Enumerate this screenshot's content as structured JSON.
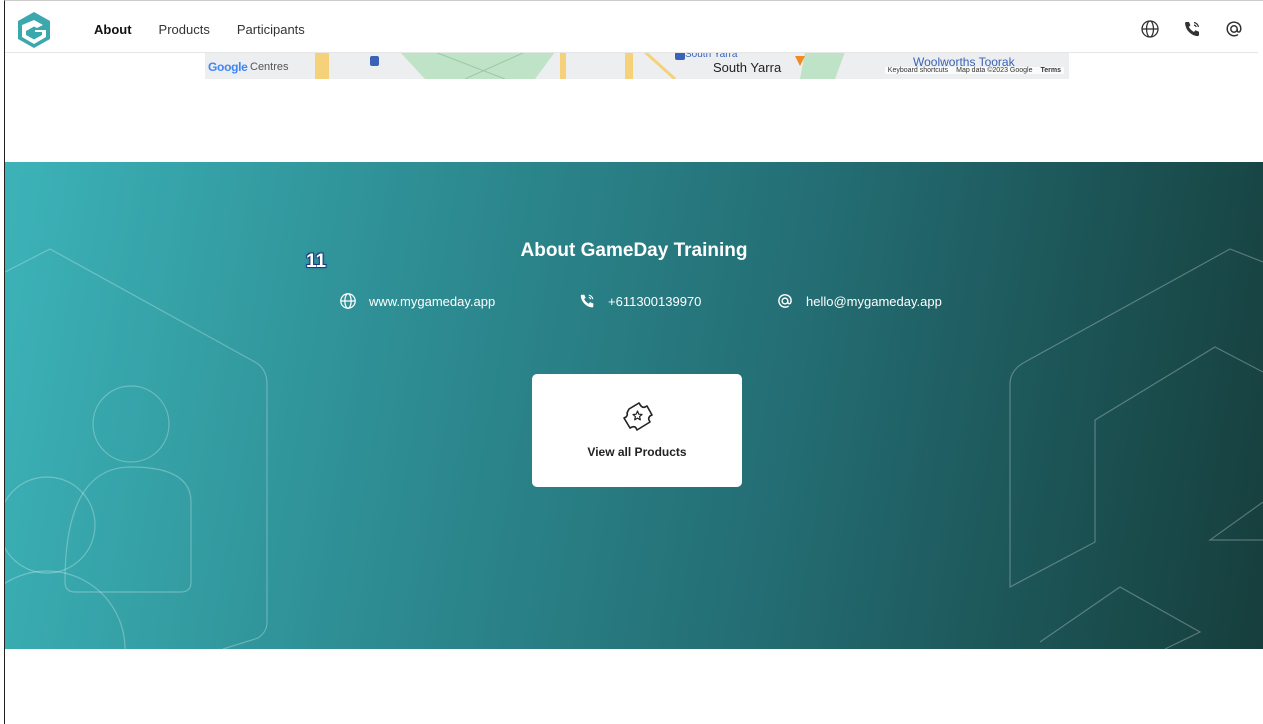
{
  "nav": {
    "items": [
      {
        "label": "About",
        "active": true
      },
      {
        "label": "Products",
        "active": false
      },
      {
        "label": "Participants",
        "active": false
      }
    ],
    "icons": [
      "globe-icon",
      "phone-icon",
      "at-icon"
    ]
  },
  "map": {
    "google": "Google",
    "centres": "Centres",
    "south_yarra": "South Yarra",
    "south_yarra_station": "South Yarra",
    "woolworths": "Woolworths Toorak",
    "keyboard_shortcuts": "Keyboard shortcuts",
    "map_data": "Map data ©2023 Google",
    "terms": "Terms"
  },
  "hero": {
    "badge": "11",
    "title": "About GameDay Training",
    "website": "www.mygameday.app",
    "phone": "+611300139970",
    "email": "hello@mygameday.app",
    "card_label": "View all Products"
  },
  "colors": {
    "teal_light": "#3cb3b8",
    "teal_dark": "#163e3c",
    "logo": "#3aa8ad"
  }
}
